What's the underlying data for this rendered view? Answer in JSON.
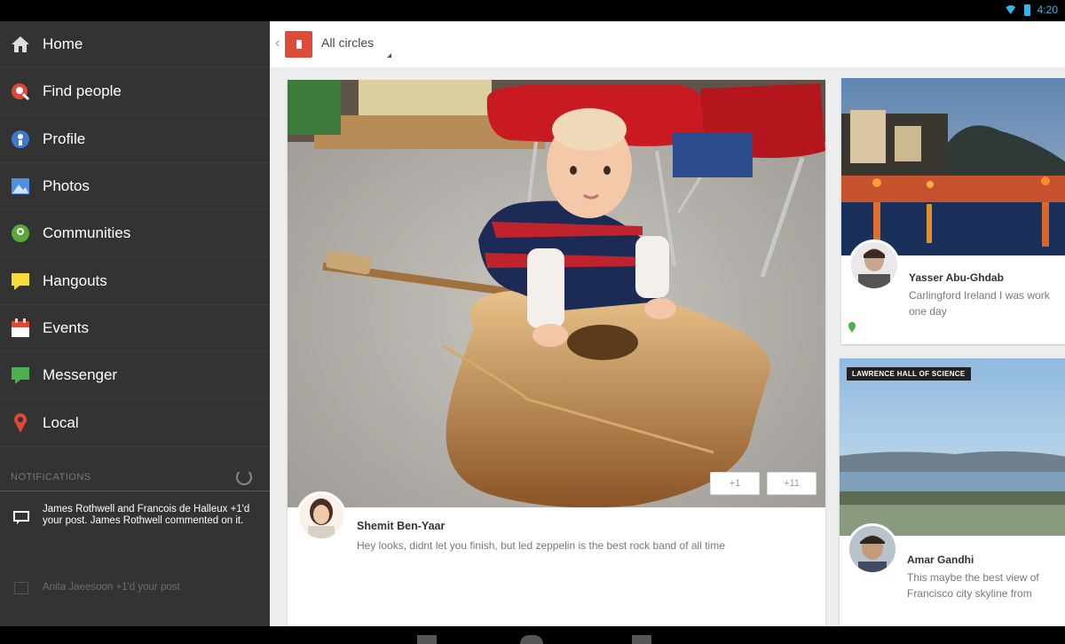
{
  "status": {
    "time": "4:20"
  },
  "drawer": {
    "items": [
      {
        "label": "Home",
        "icon": "home-icon"
      },
      {
        "label": "Find people",
        "icon": "find-people-icon"
      },
      {
        "label": "Profile",
        "icon": "profile-icon"
      },
      {
        "label": "Photos",
        "icon": "photos-icon"
      },
      {
        "label": "Communities",
        "icon": "communities-icon"
      },
      {
        "label": "Hangouts",
        "icon": "hangouts-icon"
      },
      {
        "label": "Events",
        "icon": "events-icon"
      },
      {
        "label": "Messenger",
        "icon": "messenger-icon"
      },
      {
        "label": "Local",
        "icon": "local-icon"
      }
    ],
    "notifications_label": "NOTIFICATIONS",
    "notifications": [
      {
        "text": "James Rothwell and Francois de Halleux +1'd your post. James Rothwell commented on it."
      },
      {
        "text": "Anita Jaeesoon +1'd your post"
      }
    ]
  },
  "topbar": {
    "title": "All circles"
  },
  "posts": [
    {
      "author": "Shemit Ben-Yaar",
      "text": "Hey looks, didnt let you finish, but led zeppelin is the best rock band of all time",
      "plus_count": "+1",
      "share_count": "+11"
    },
    {
      "author": "Yasser Abu-Ghdab",
      "text": "Carlingford Ireland I was work one day"
    },
    {
      "author": "Amar Gandhi",
      "text": "This maybe the best view of Francisco city skyline from",
      "tag": "LAWRENCE HALL OF SCIENCE"
    }
  ],
  "colors": {
    "brand": "#dd4b39",
    "drawer_bg": "#333333",
    "accent": "#33b5e5"
  }
}
